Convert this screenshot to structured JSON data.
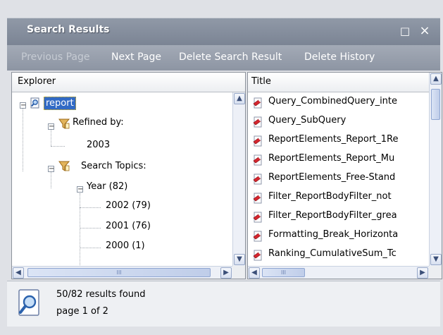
{
  "window": {
    "title": "Search Results",
    "restore_glyph": "□",
    "close_glyph": "×"
  },
  "toolbar": {
    "previous_page": "Previous Page",
    "next_page": "Next Page",
    "delete_search_result": "Delete Search Result",
    "delete_history": "Delete History"
  },
  "explorer": {
    "header": "Explorer",
    "tree": {
      "root": "report",
      "refined_by": "Refined by:",
      "refined_value": "2003",
      "search_topics": "Search Topics:",
      "year": "Year (82)",
      "year_items": [
        "2002 (79)",
        "2001 (76)",
        "2000 (1)"
      ]
    },
    "scrollbar_glyph": "III"
  },
  "results": {
    "header": "Title",
    "items": [
      "Query_CombinedQuery_inte",
      "Query_SubQuery",
      "ReportElements_Report_1Re",
      "ReportElements_Report_Mu",
      "ReportElements_Free-Stand",
      "Filter_ReportBodyFilter_not",
      "Filter_ReportBodyFilter_grea",
      "Formatting_Break_Horizonta",
      "Ranking_CumulativeSum_Tc"
    ],
    "scrollbar_glyph": "III"
  },
  "status": {
    "found": "50/82 results found",
    "page": "page 1 of 2"
  },
  "colors": {
    "header_bar": "#7b8494",
    "toolbar": "#8d95a3",
    "selection": "#316ac5",
    "result_icon": "#d6262f"
  }
}
